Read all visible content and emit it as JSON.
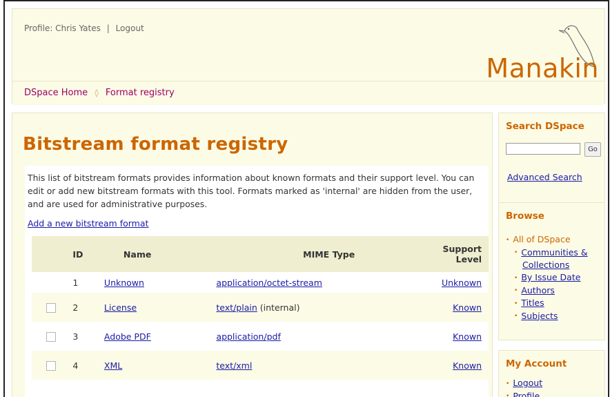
{
  "header": {
    "profile_label": "Profile: Chris Yates",
    "separator": "|",
    "logout_label": "Logout",
    "logo_text": "Manakin",
    "trail": {
      "home": "DSpace Home",
      "arrow": "◊",
      "current": "Format registry"
    }
  },
  "main": {
    "title": "Bitstream format registry",
    "intro": "This list of bitstream formats provides information about known formats and their support level. You can edit or add new bitstream formats with this tool. Formats marked as 'internal' are hidden from the user, and are used for administrative purposes.",
    "add_link": "Add a new bitstream format",
    "table": {
      "headers": {
        "id": "ID",
        "name": "Name",
        "mime": "MIME Type",
        "level_1": "Support",
        "level_2": "Level"
      },
      "rows": [
        {
          "id": "1",
          "name": "Unknown",
          "mime": "application/octet-stream",
          "internal": "",
          "level": "Unknown",
          "checkbox": false
        },
        {
          "id": "2",
          "name": "License",
          "mime": "text/plain",
          "internal": "(internal)",
          "level": "Known",
          "checkbox": true
        },
        {
          "id": "3",
          "name": "Adobe PDF",
          "mime": "application/pdf",
          "internal": "",
          "level": "Known",
          "checkbox": true
        },
        {
          "id": "4",
          "name": "XML",
          "mime": "text/xml",
          "internal": "",
          "level": "Known",
          "checkbox": true
        }
      ]
    }
  },
  "sidebar": {
    "search": {
      "title": "Search DSpace",
      "input_value": "",
      "go_label": "Go",
      "advanced_label": "Advanced Search"
    },
    "browse": {
      "title": "Browse",
      "root": "All of DSpace",
      "items": [
        "Communities & Collections",
        "By Issue Date",
        "Authors",
        "Titles",
        "Subjects"
      ]
    },
    "account": {
      "title": "My Account",
      "items": [
        "Logout",
        "Profile"
      ]
    }
  },
  "colors": {
    "accent": "#cc6600",
    "panel": "#fcfbe6",
    "link": "#1a1aa6",
    "trail": "#990066"
  }
}
